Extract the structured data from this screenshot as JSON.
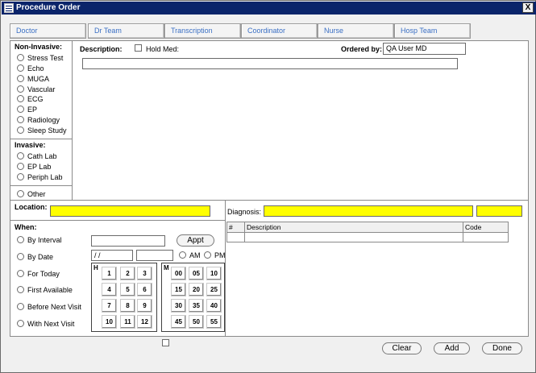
{
  "window": {
    "title": "Procedure Order",
    "close_label": "X"
  },
  "tabs": [
    {
      "label": "Doctor"
    },
    {
      "label": "Dr Team"
    },
    {
      "label": "Transcription"
    },
    {
      "label": "Coordinator"
    },
    {
      "label": "Nurse"
    },
    {
      "label": "Hosp Team"
    }
  ],
  "noninvasive": {
    "heading": "Non-Invasive:",
    "items": [
      "Stress Test",
      "Echo",
      "MUGA",
      "Vascular",
      "ECG",
      "EP",
      "Radiology",
      "Sleep Study"
    ]
  },
  "invasive": {
    "heading": "Invasive:",
    "items": [
      "Cath Lab",
      "EP Lab",
      "Periph Lab"
    ]
  },
  "other": {
    "label": "Other"
  },
  "description": {
    "label": "Description:",
    "hold_med": "Hold Med:",
    "ordered_by_label": "Ordered by:",
    "ordered_by_value": "QA User MD",
    "text": ""
  },
  "location": {
    "label": "Location:",
    "value": ""
  },
  "diagnosis": {
    "label": "Diagnosis:",
    "columns": [
      "#",
      "Description",
      "Code"
    ],
    "rows": []
  },
  "when": {
    "heading": "When:",
    "options": [
      "By Interval",
      "By Date",
      "For Today",
      "First Available",
      "Before Next Visit",
      "With Next Visit"
    ],
    "appt_label": "Appt",
    "date_value": "/ /",
    "am_label": "AM",
    "pm_label": "PM"
  },
  "hours_keypad": {
    "label": "H",
    "keys": [
      "1",
      "2",
      "3",
      "4",
      "5",
      "6",
      "7",
      "8",
      "9",
      "10",
      "11",
      "12"
    ]
  },
  "minutes_keypad": {
    "label": "M",
    "keys": [
      "00",
      "05",
      "10",
      "15",
      "20",
      "25",
      "30",
      "35",
      "40",
      "45",
      "50",
      "55"
    ]
  },
  "actions": {
    "clear": "Clear",
    "add": "Add",
    "done": "Done"
  },
  "colors": {
    "titlebar": "#0a246a",
    "tab_text": "#3a6fc4",
    "highlight": "#ffff00"
  }
}
